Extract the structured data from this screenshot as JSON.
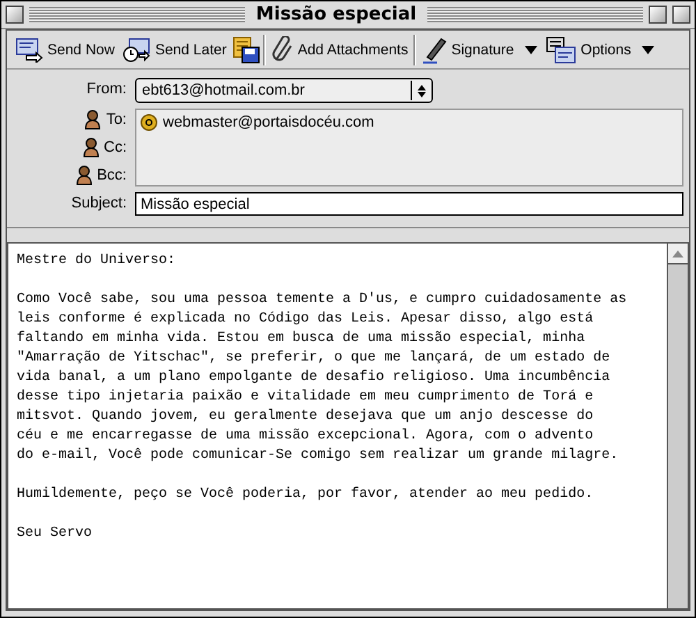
{
  "window": {
    "title": "Missão especial"
  },
  "toolbar": [
    {
      "kind": "button",
      "label": "Send Now"
    },
    {
      "kind": "button",
      "label": "Send Later"
    },
    {
      "kind": "icon"
    },
    {
      "kind": "button",
      "label": "Add Attachments"
    },
    {
      "kind": "menu",
      "label": "Signature"
    },
    {
      "kind": "menu",
      "label": "Options"
    }
  ],
  "from": {
    "label": "From:",
    "value": "ebt613@hotmail.com.br"
  },
  "recipients": [
    {
      "label": "To:",
      "addresses": [
        "webmaster@portaisdocéu.com"
      ]
    },
    {
      "label": "Cc:"
    },
    {
      "label": "Bcc:"
    }
  ],
  "subject": {
    "label": "Subject:",
    "value": "Missão especial"
  },
  "body": [
    "Mestre do Universo:",
    "Como Você sabe, sou uma pessoa temente a D'us, e cumpro cuidadosamente as\nleis conforme é explicada no Código das Leis. Apesar disso, algo está\nfaltando em minha vida. Estou em busca de uma missão especial, minha\n\"Amarração de Yitschac\", se preferir, o que me lançará, de um estado de\nvida banal, a um plano empolgante de desafio religioso. Uma incumbência\ndesse tipo injetaria paixão e vitalidade em meu cumprimento de Torá e\nmitsvot. Quando jovem, eu geralmente desejava que um anjo descesse do\ncéu e me encarregasse de uma missão excepcional. Agora, com o advento\ndo e-mail, Você pode comunicar-Se comigo sem realizar um grande milagre.",
    "Humildemente, peço se Você poderia, por favor, atender ao meu pedido.",
    "Seu Servo"
  ]
}
